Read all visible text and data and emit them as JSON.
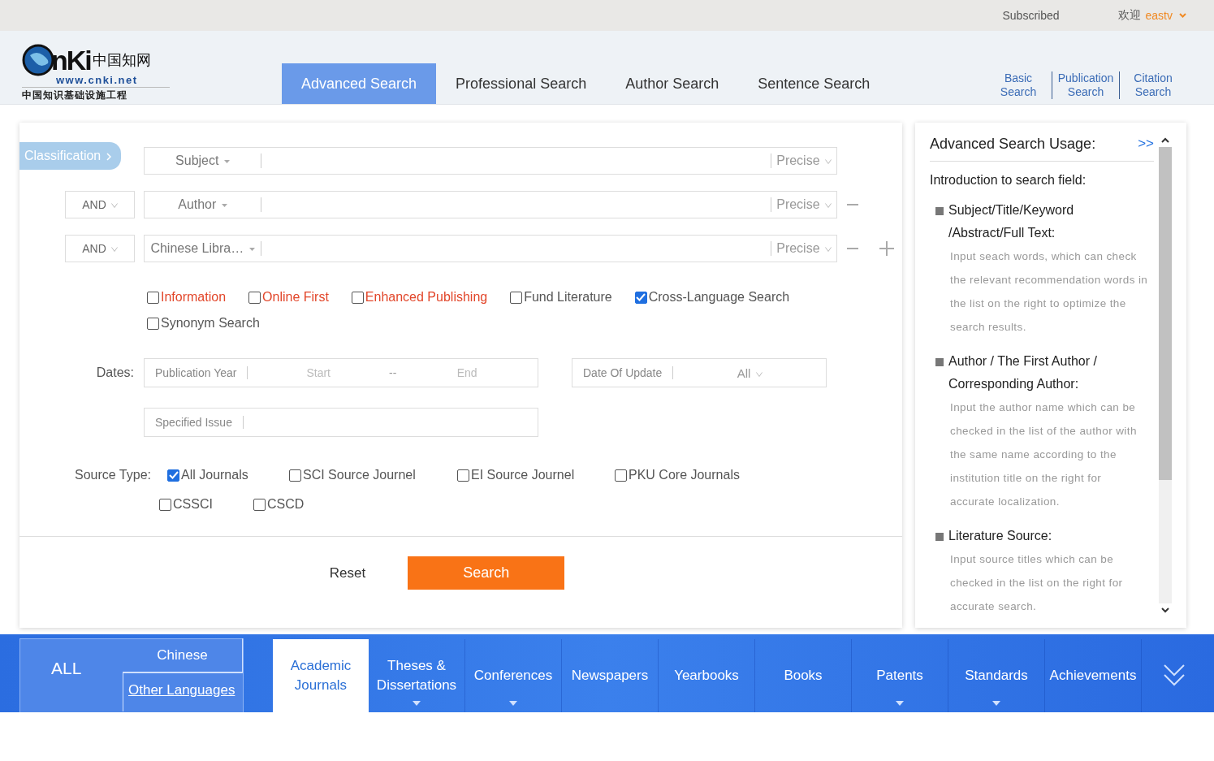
{
  "top_bar": {
    "subscribed": "Subscribed",
    "welcome": "欢迎",
    "user": "eastv"
  },
  "logo": {
    "brand": "nKi",
    "chinese": "中国知网",
    "url": "www.cnki.net",
    "tagline": "中国知识基础设施工程"
  },
  "search_tabs": [
    {
      "label": "Advanced Search",
      "selected": true
    },
    {
      "label": "Professional Search",
      "selected": false
    },
    {
      "label": "Author Search",
      "selected": false
    },
    {
      "label": "Sentence Search",
      "selected": false
    }
  ],
  "other_searches": [
    "Basic Search",
    "Publication Search",
    "Citation Search"
  ],
  "classification": "Classification",
  "query_rows": [
    {
      "field": "Subject",
      "match": "Precise",
      "removable": false,
      "addable": false
    },
    {
      "logic": "AND",
      "field": "Author",
      "match": "Precise",
      "removable": true,
      "addable": false
    },
    {
      "logic": "AND",
      "field": "Chinese Libra…",
      "match": "Precise",
      "removable": true,
      "addable": true
    }
  ],
  "options": [
    {
      "label": "Information",
      "checked": false,
      "emphasis": true
    },
    {
      "label": "Online First",
      "checked": false,
      "emphasis": true
    },
    {
      "label": "Enhanced Publishing",
      "checked": false,
      "emphasis": true
    },
    {
      "label": "Fund Literature",
      "checked": false,
      "emphasis": false
    },
    {
      "label": "Cross-Language Search",
      "checked": true,
      "emphasis": false
    },
    {
      "label": "Synonym Search",
      "checked": false,
      "emphasis": false
    }
  ],
  "dates": {
    "label": "Dates:",
    "publication_year": {
      "label": "Publication Year",
      "start": "Start",
      "separator": "--",
      "end": "End"
    },
    "update": {
      "label": "Date Of Update",
      "value": "All"
    },
    "specified_issue": "Specified Issue"
  },
  "source_type": {
    "label": "Source Type:",
    "options": [
      {
        "label": "All Journals",
        "checked": true
      },
      {
        "label": "SCI Source Journel",
        "checked": false
      },
      {
        "label": "EI Source Journel",
        "checked": false
      },
      {
        "label": "PKU Core Journals",
        "checked": false
      },
      {
        "label": "CSSCI",
        "checked": false
      },
      {
        "label": "CSCD",
        "checked": false
      }
    ]
  },
  "buttons": {
    "reset": "Reset",
    "search": "Search"
  },
  "usage": {
    "title": "Advanced Search Usage:",
    "more": ">>",
    "intro": "Introduction to search field:",
    "sections": [
      {
        "heading": "Subject/Title/Keyword /Abstract/Full Text:",
        "body": "Input seach words, which can check the relevant recommendation words in the list on the right to optimize the search results."
      },
      {
        "heading": "Author / The First Author / Corresponding Author:",
        "body": "Input the author name which can be checked in the list of the author with the same name according to the institution title on the right for accurate localization."
      },
      {
        "heading": "Literature Source:",
        "body": "Input source titles which can be checked in the list on the right for accurate search."
      }
    ]
  },
  "bottom_nav": {
    "all": "ALL",
    "languages": [
      {
        "label": "Chinese",
        "selected": true
      },
      {
        "label": "Other Languages",
        "selected": false
      }
    ],
    "categories": [
      {
        "label": "Academic Journals",
        "selected": true,
        "dropdown": false
      },
      {
        "label": "Theses & Dissertations",
        "selected": false,
        "dropdown": true
      },
      {
        "label": "Conferences",
        "selected": false,
        "dropdown": true
      },
      {
        "label": "Newspapers",
        "selected": false,
        "dropdown": false
      },
      {
        "label": "Yearbooks",
        "selected": false,
        "dropdown": false
      },
      {
        "label": "Books",
        "selected": false,
        "dropdown": false
      },
      {
        "label": "Patents",
        "selected": false,
        "dropdown": true
      },
      {
        "label": "Standards",
        "selected": false,
        "dropdown": true
      },
      {
        "label": "Achievements",
        "selected": false,
        "dropdown": false
      }
    ]
  }
}
